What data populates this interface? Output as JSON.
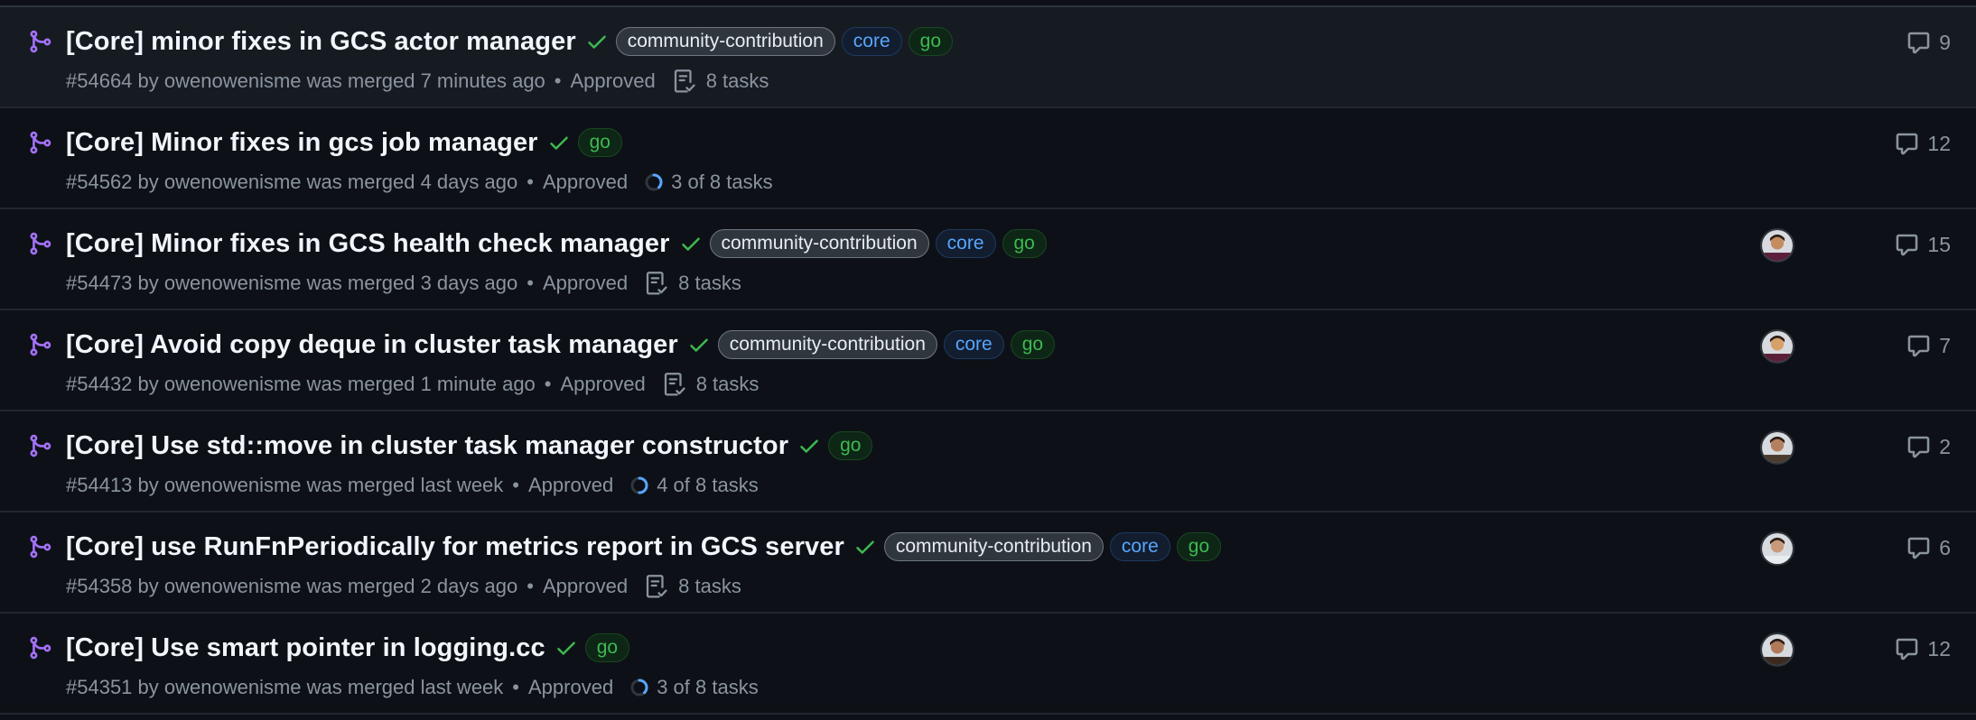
{
  "colors": {
    "background": "#0d1117",
    "merged_icon": "#a371f7",
    "check": "#3fb950",
    "muted": "#8b949e",
    "label_core": "#58a6ff",
    "label_go": "#3fb950"
  },
  "pull_requests": [
    {
      "title": "[Core] minor fixes in GCS actor manager",
      "labels": [
        "community-contribution",
        "core",
        "go"
      ],
      "number": "#54664",
      "meta": "by owenowenisme was merged 7 minutes ago",
      "review": "Approved",
      "tasks": "8 tasks",
      "task_icon": "tasklist-icon",
      "comments": "9",
      "has_avatar": false
    },
    {
      "title": "[Core] Minor fixes in gcs job manager",
      "labels": [
        "go"
      ],
      "number": "#54562",
      "meta": "by owenowenisme was merged 4 days ago",
      "review": "Approved",
      "tasks": "3 of 8 tasks",
      "task_icon": "progress-icon",
      "task_progress": 0.375,
      "comments": "12",
      "has_avatar": false
    },
    {
      "title": "[Core] Minor fixes in GCS health check manager",
      "labels": [
        "community-contribution",
        "core",
        "go"
      ],
      "number": "#54473",
      "meta": "by owenowenisme was merged 3 days ago",
      "review": "Approved",
      "tasks": "8 tasks",
      "task_icon": "tasklist-icon",
      "comments": "15",
      "has_avatar": true
    },
    {
      "title": "[Core] Avoid copy deque in cluster task manager",
      "labels": [
        "community-contribution",
        "core",
        "go"
      ],
      "number": "#54432",
      "meta": "by owenowenisme was merged 1 minute ago",
      "review": "Approved",
      "tasks": "8 tasks",
      "task_icon": "tasklist-icon",
      "comments": "7",
      "has_avatar": true
    },
    {
      "title": "[Core] Use std::move in cluster task manager constructor",
      "labels": [
        "go"
      ],
      "number": "#54413",
      "meta": "by owenowenisme was merged last week",
      "review": "Approved",
      "tasks": "4 of 8 tasks",
      "task_icon": "progress-icon",
      "task_progress": 0.5,
      "comments": "2",
      "has_avatar": true
    },
    {
      "title": "[Core] use RunFnPeriodically for metrics report in GCS server",
      "labels": [
        "community-contribution",
        "core",
        "go"
      ],
      "number": "#54358",
      "meta": "by owenowenisme was merged 2 days ago",
      "review": "Approved",
      "tasks": "8 tasks",
      "task_icon": "tasklist-icon",
      "comments": "6",
      "has_avatar": true
    },
    {
      "title": "[Core] Use smart pointer in logging.cc",
      "labels": [
        "go"
      ],
      "number": "#54351",
      "meta": "by owenowenisme was merged last week",
      "review": "Approved",
      "tasks": "3 of 8 tasks",
      "task_icon": "progress-icon",
      "task_progress": 0.375,
      "comments": "12",
      "has_avatar": true
    }
  ]
}
